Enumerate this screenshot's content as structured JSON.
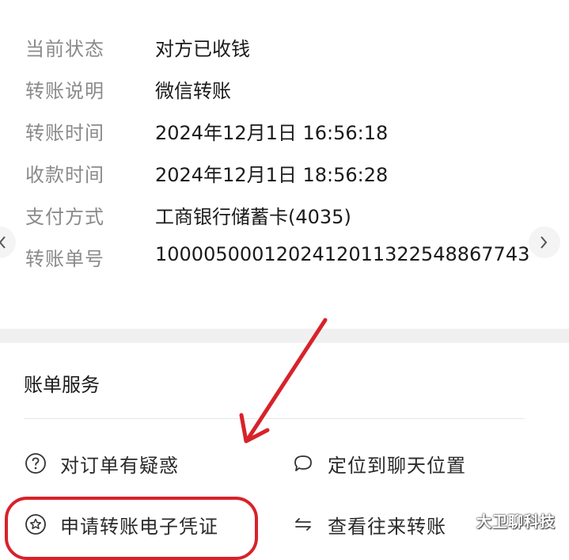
{
  "details": [
    {
      "label": "当前状态",
      "value": "对方已收钱"
    },
    {
      "label": "转账说明",
      "value": "微信转账"
    },
    {
      "label": "转账时间",
      "value": "2024年12月1日 16:56:18"
    },
    {
      "label": "收款时间",
      "value": "2024年12月1日 18:56:28"
    },
    {
      "label": "支付方式",
      "value": "工商银行储蓄卡(4035)"
    },
    {
      "label": "转账单号",
      "value": "100005000120241201132254886774​3"
    }
  ],
  "services": {
    "title": "账单服务",
    "items": [
      {
        "label": "对订单有疑惑",
        "icon": "question-circle-icon"
      },
      {
        "label": "定位到聊天位置",
        "icon": "chat-bubble-icon"
      },
      {
        "label": "申请转账电子凭证",
        "icon": "star-circle-icon"
      },
      {
        "label": "查看往来转账",
        "icon": "transfer-arrows-icon"
      }
    ]
  },
  "watermark": "大卫聊科技",
  "colors": {
    "annotation_red": "#d8222a",
    "label_gray": "#8a8a8a"
  }
}
